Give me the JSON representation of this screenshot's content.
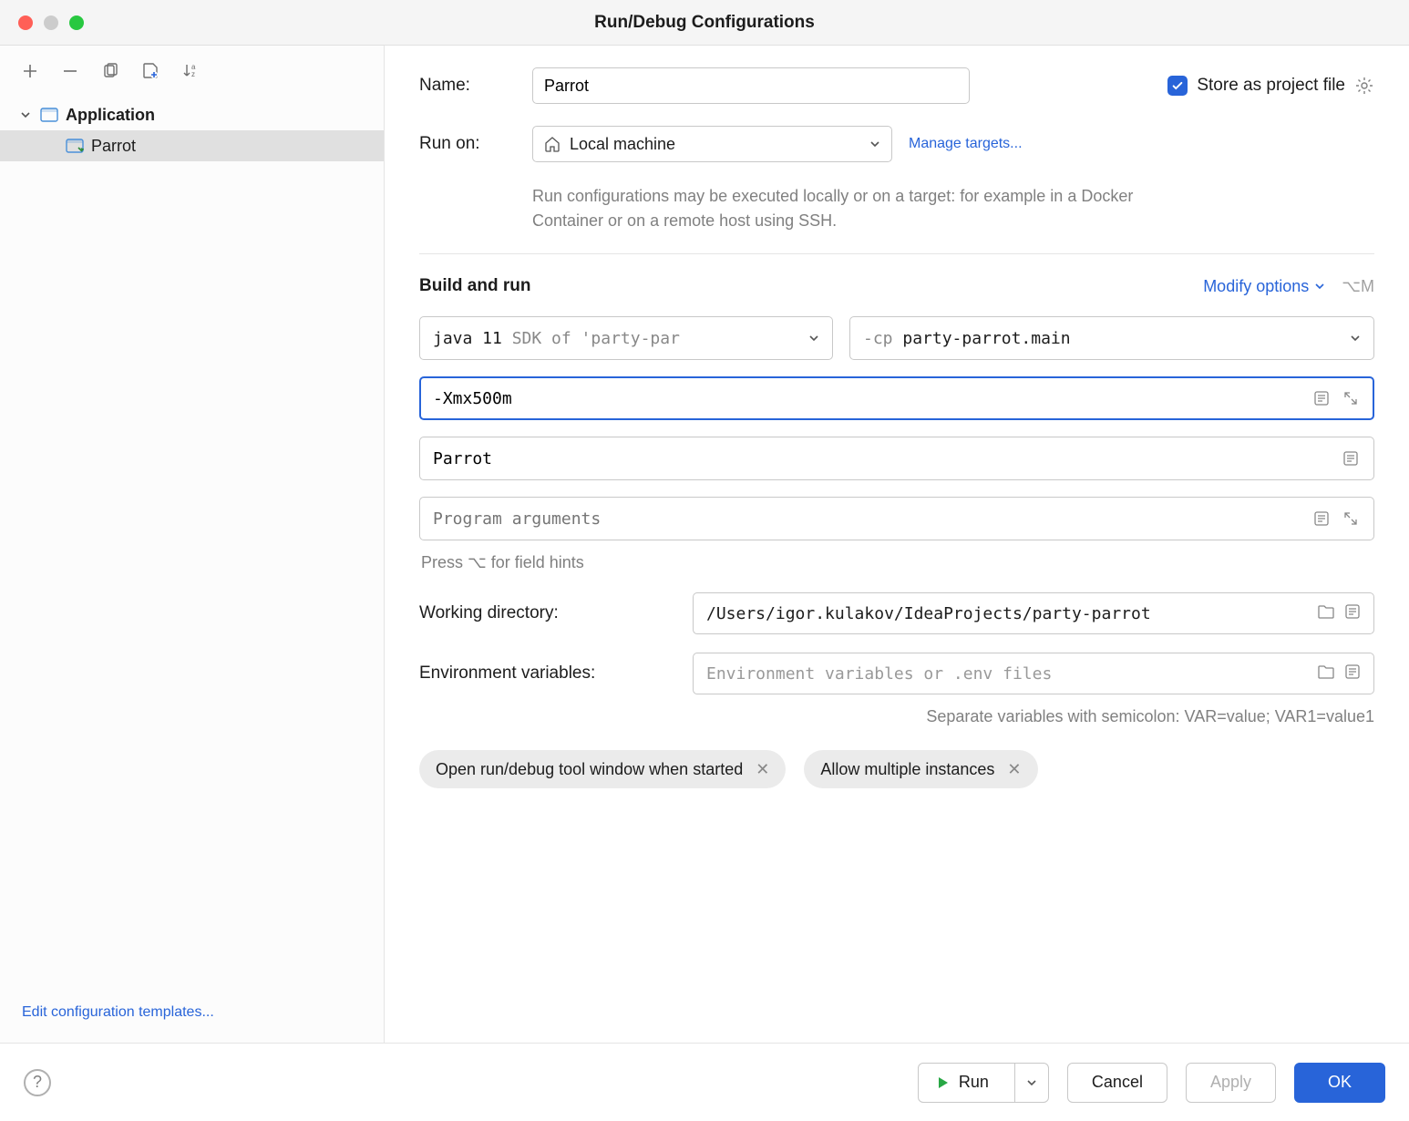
{
  "title": "Run/Debug Configurations",
  "sidebar": {
    "category": "Application",
    "items": [
      {
        "label": "Parrot"
      }
    ],
    "footer_link": "Edit configuration templates..."
  },
  "name": {
    "label": "Name:",
    "value": "Parrot"
  },
  "store": {
    "label": "Store as project file",
    "checked": true
  },
  "runon": {
    "label": "Run on:",
    "value": "Local machine",
    "manage": "Manage targets...",
    "hint": "Run configurations may be executed locally or on a target: for example in a Docker Container or on a remote host using SSH."
  },
  "section": {
    "title": "Build and run",
    "modify": "Modify options",
    "shortcut": "⌥M"
  },
  "java": {
    "value": "java 11",
    "suffix": "SDK of 'party-par"
  },
  "cp": {
    "prefix": "-cp",
    "value": "party-parrot.main"
  },
  "vmoptions": {
    "value": "-Xmx500m"
  },
  "mainclass": {
    "value": "Parrot"
  },
  "programargs": {
    "placeholder": "Program arguments"
  },
  "fieldhint": "Press ⌥ for field hints",
  "workdir": {
    "label": "Working directory:",
    "value": "/Users/igor.kulakov/IdeaProjects/party-parrot"
  },
  "envvars": {
    "label": "Environment variables:",
    "placeholder": "Environment variables or .env files",
    "hint": "Separate variables with semicolon: VAR=value; VAR1=value1"
  },
  "pills": {
    "openwin": "Open run/debug tool window when started",
    "multi": "Allow multiple instances"
  },
  "buttons": {
    "run": "Run",
    "cancel": "Cancel",
    "apply": "Apply",
    "ok": "OK"
  }
}
